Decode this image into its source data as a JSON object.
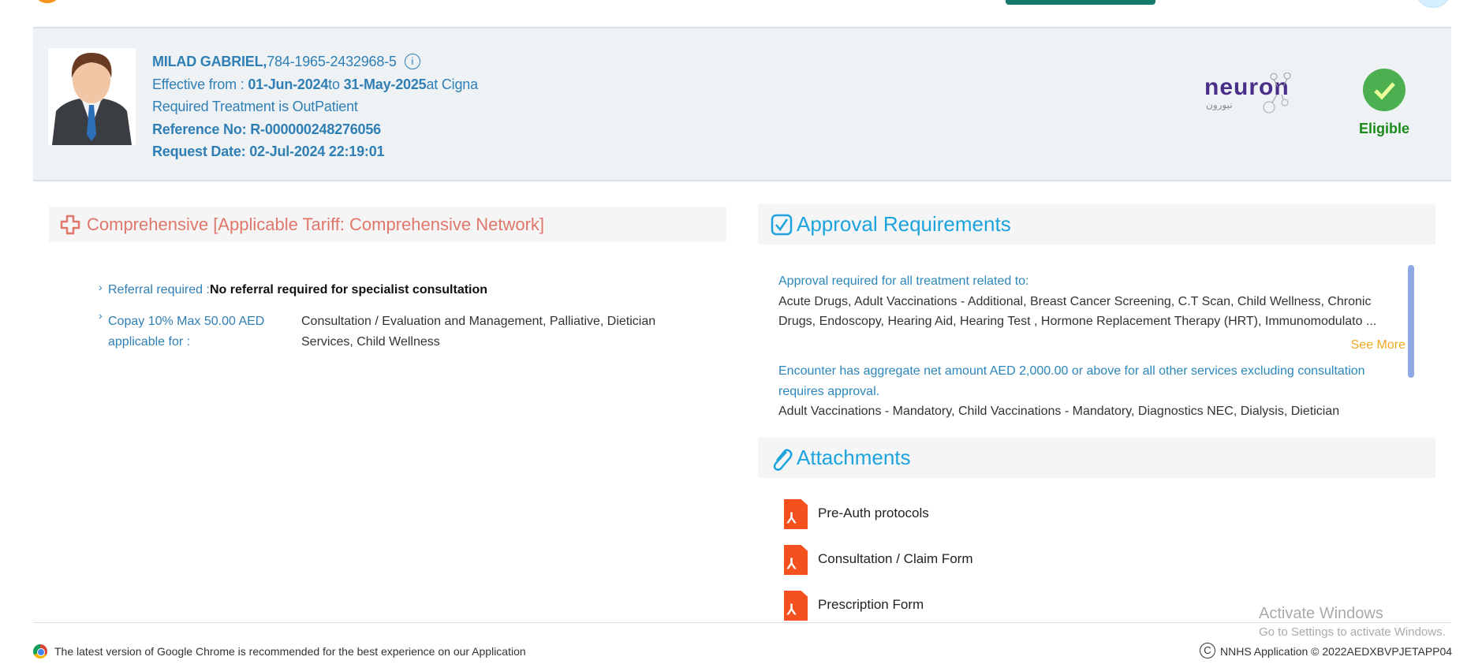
{
  "member": {
    "name": "MILAD GABRIEL,",
    "id": "784-1965-2432968-5",
    "info_icon": "i",
    "effective_prefix": "Effective from : ",
    "effective_from": "01-Jun-2024",
    "to_label": "to ",
    "effective_to": "31-May-2025",
    "insurer_text": "at Cigna",
    "treatment": "Required Treatment is OutPatient",
    "reference": "Reference No: R-000000248276056",
    "request_date": "Request Date: 02-Jul-2024 22:19:01",
    "logo_text": "neuron",
    "logo_arabic": "نيورون",
    "status": "Eligible",
    "status_color": "#4caf50"
  },
  "plan": {
    "title": "Comprehensive [Applicable Tariff: Comprehensive Network]",
    "referral_label": "Referral required :",
    "referral_value": "No referral required for specialist consultation",
    "copay_label": "Copay 10% Max 50.00 AED applicable for :",
    "copay_value": "Consultation / Evaluation and Management, Palliative, Dietician Services, Child Wellness"
  },
  "approval": {
    "title": "Approval Requirements",
    "rule1_heading": "Approval required for all treatment related to:",
    "rule1_items": "Acute Drugs, Adult Vaccinations - Additional, Breast Cancer Screening, C.T Scan, Child Wellness, Chronic Drugs, Endoscopy, Hearing Aid, Hearing Test , Hormone Replacement Therapy (HRT), Immunomodulato ...",
    "see_more": "See More",
    "rule2_heading": "Encounter has aggregate net amount AED 2,000.00 or above for all other services excluding consultation requires approval.",
    "rule2_items": "Adult Vaccinations - Mandatory, Child Vaccinations - Mandatory, Diagnostics NEC, Dialysis, Dietician"
  },
  "attachments": {
    "title": "Attachments",
    "items": [
      {
        "label": "Pre-Auth protocols"
      },
      {
        "label": "Consultation / Claim Form"
      },
      {
        "label": "Prescription Form"
      }
    ]
  },
  "footer": {
    "browser_note": "The latest version of Google Chrome is recommended for the best experience on our Application",
    "copyright": "NNHS Application © 2022AEDXBVPJETAPP04",
    "activate_title": "Activate Windows",
    "activate_sub": "Go to Settings to activate Windows."
  }
}
